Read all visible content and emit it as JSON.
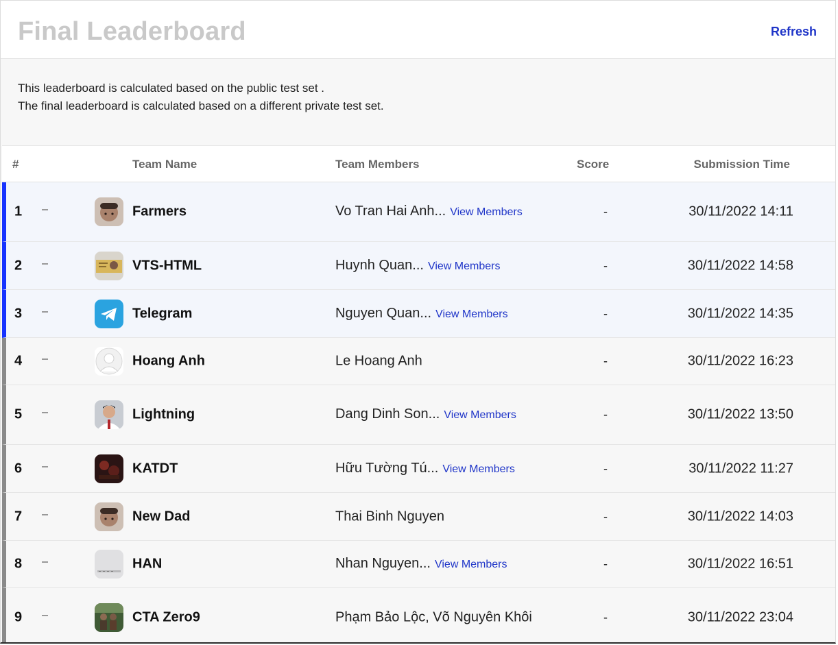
{
  "header": {
    "title": "Final Leaderboard",
    "refresh_label": "Refresh"
  },
  "description": {
    "line1": "This leaderboard is calculated based on the public test set .",
    "line2": "The final leaderboard is calculated based on a different private test set."
  },
  "table": {
    "columns": {
      "rank": "#",
      "team": "Team Name",
      "members": "Team Members",
      "score": "Score",
      "time": "Submission Time"
    },
    "rows": [
      {
        "rank": "1",
        "team": "Farmers",
        "members": "Vo Tran Hai Anh...",
        "view": "View Members",
        "score": "-",
        "time": "30/11/2022 14:11",
        "avatar_icon": "baby-photo-avatar"
      },
      {
        "rank": "2",
        "team": "VTS-HTML",
        "members": "Huynh Quan...",
        "view": "View Members",
        "score": "-",
        "time": "30/11/2022 14:58",
        "avatar_icon": "id-card-avatar"
      },
      {
        "rank": "3",
        "team": "Telegram",
        "members": "Nguyen Quan...",
        "view": "View Members",
        "score": "-",
        "time": "30/11/2022 14:35",
        "avatar_icon": "telegram-logo-avatar"
      },
      {
        "rank": "4",
        "team": "Hoang Anh",
        "members": "Le Hoang Anh",
        "view": "",
        "score": "-",
        "time": "30/11/2022 16:23",
        "avatar_icon": "default-user-avatar"
      },
      {
        "rank": "5",
        "team": "Lightning",
        "members": "Dang Dinh Son...",
        "view": "View Members",
        "score": "-",
        "time": "30/11/2022 13:50",
        "avatar_icon": "man-portrait-avatar"
      },
      {
        "rank": "6",
        "team": "KATDT",
        "members": "Hữu Tường Tú...",
        "view": "View Members",
        "score": "-",
        "time": "30/11/2022 11:27",
        "avatar_icon": "dark-scene-avatar"
      },
      {
        "rank": "7",
        "team": "New Dad",
        "members": "Thai Binh Nguyen",
        "view": "",
        "score": "-",
        "time": "30/11/2022 14:03",
        "avatar_icon": "baby-photo-avatar"
      },
      {
        "rank": "8",
        "team": "HAN",
        "members": "Nhan Nguyen...",
        "view": "View Members",
        "score": "-",
        "time": "30/11/2022 16:51",
        "avatar_icon": "gray-placeholder-avatar"
      },
      {
        "rank": "9",
        "team": "CTA Zero9",
        "members": "Phạm Bảo Lộc, Võ Nguyên Khôi",
        "view": "",
        "score": "-",
        "time": "30/11/2022 23:04",
        "avatar_icon": "outdoor-group-avatar"
      }
    ]
  },
  "colors": {
    "accent": "#1f35c8",
    "top_rank_bar": "#1733ff",
    "rank_bar": "#8a8a8a",
    "title_gray": "#c9c9c9"
  }
}
